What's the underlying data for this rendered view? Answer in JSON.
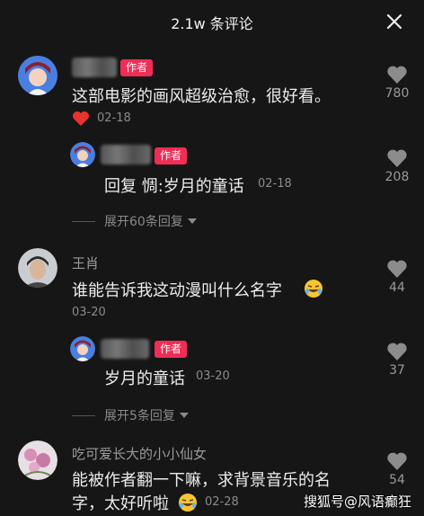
{
  "header": {
    "title": "2.1w 条评论"
  },
  "comments": [
    {
      "badge": "作者",
      "text": "这部电影的画风超级治愈，很好看。",
      "date": "02-18",
      "likes": "780",
      "reply": {
        "badge": "作者",
        "text": "回复 惆:岁月的童话",
        "date": "02-18",
        "likes": "208"
      },
      "expand": "展开60条回复"
    },
    {
      "username": "王肖",
      "text": "谁能告诉我这动漫叫什么名字",
      "date": "03-20",
      "likes": "44",
      "reply": {
        "badge": "作者",
        "text": "岁月的童话",
        "date": "03-20",
        "likes": "37"
      },
      "expand": "展开5条回复"
    },
    {
      "username": "吃可爱长大的小小仙女",
      "text_line1": "能被作者翻一下嘛，求背景音乐的名",
      "text_line2": "字，太好听啦",
      "date": "02-28",
      "likes": "54"
    }
  ],
  "watermark": "搜狐号@风语癫狂"
}
